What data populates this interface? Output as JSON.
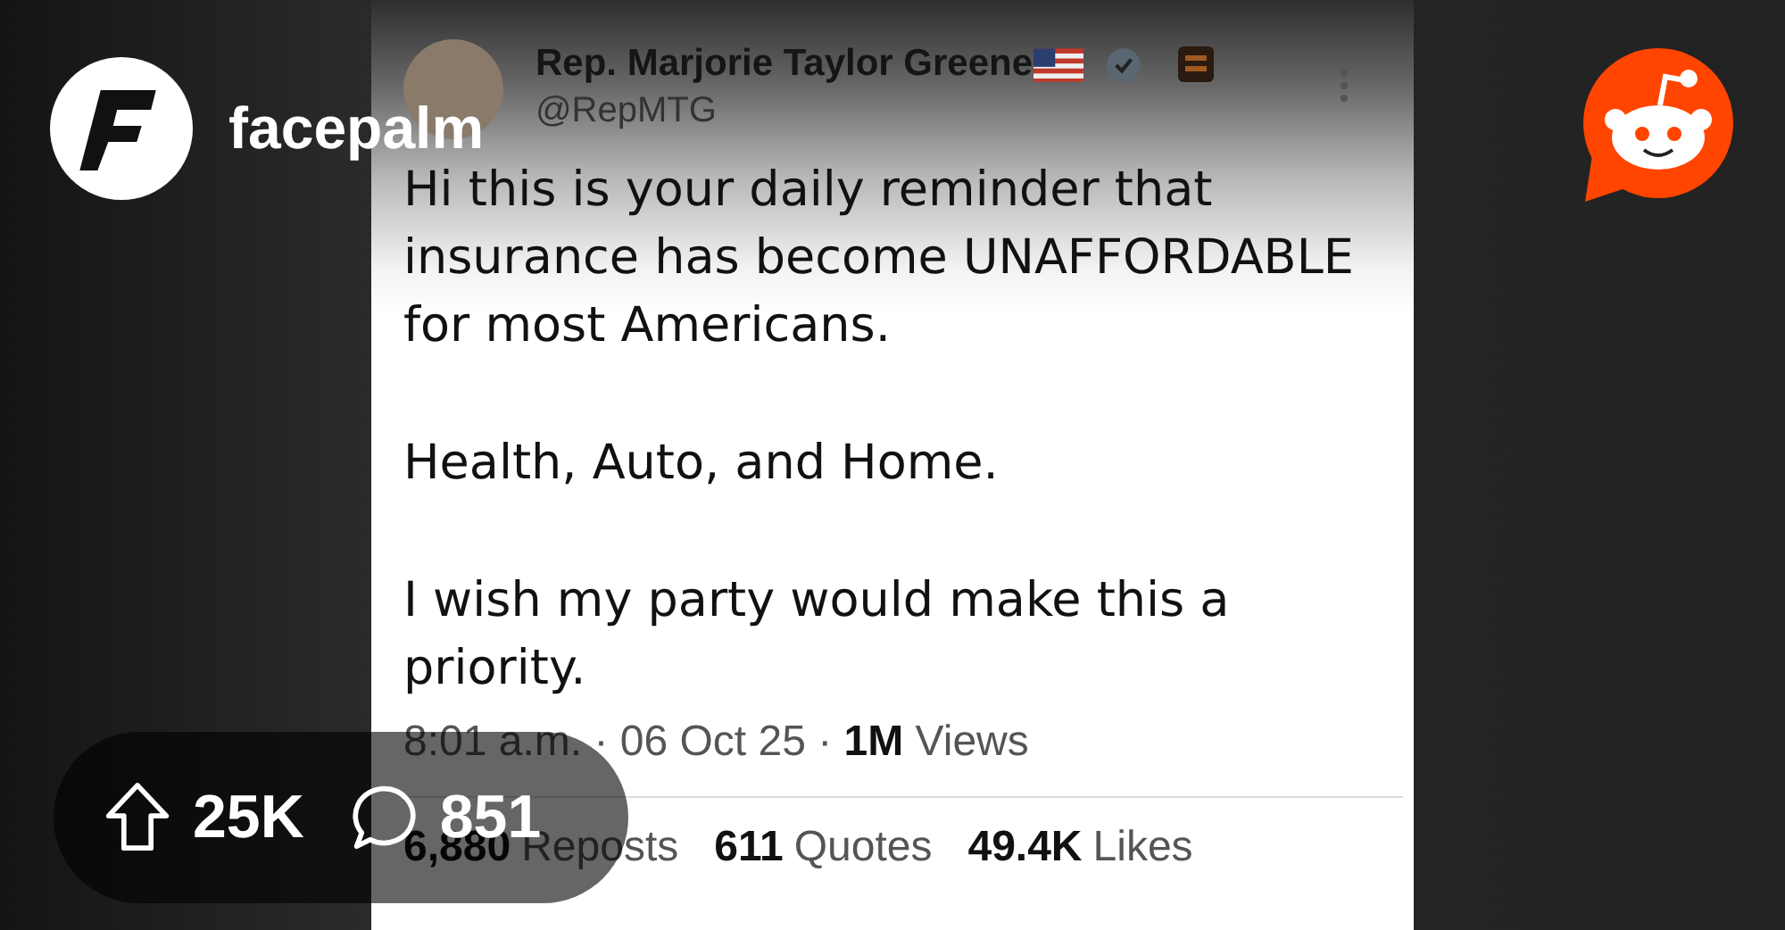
{
  "subreddit": {
    "name": "facepalm"
  },
  "tweet": {
    "author": "Rep. Marjorie Taylor Greene",
    "handle": "@RepMTG",
    "paragraphs": [
      "Hi this is your daily reminder that insurance has become UNAFFORDABLE for most Americans.",
      "Health, Auto, and Home.",
      "I wish my party would make this a priority."
    ],
    "meta": "8:01 a.m. · 06 Oct 25 · **1M** Views",
    "stats": [
      {
        "count": "6,880",
        "label": "Reposts"
      },
      {
        "count": "611",
        "label": "Quotes"
      },
      {
        "count": "49.4K",
        "label": "Likes"
      }
    ]
  },
  "post": {
    "upvotes": "25K",
    "comments": "851"
  }
}
